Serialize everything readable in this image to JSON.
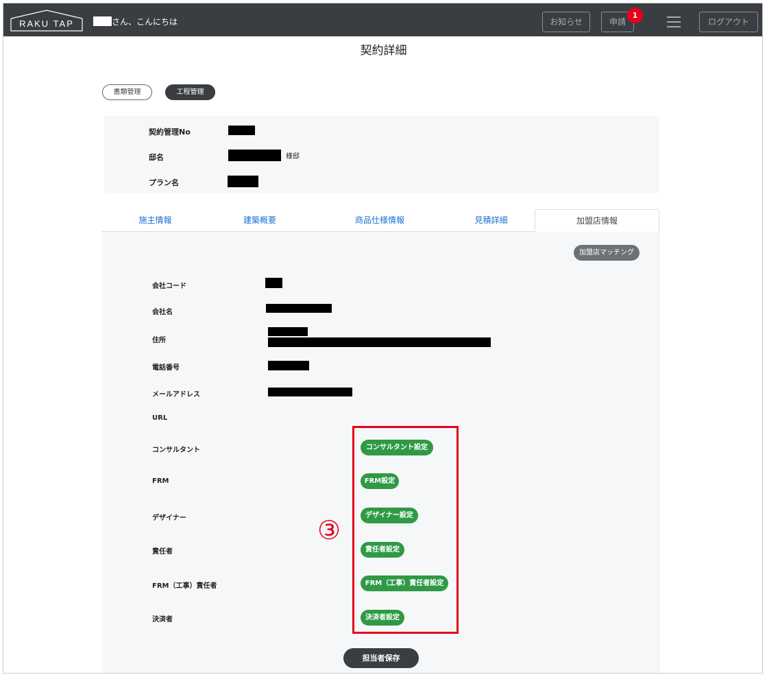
{
  "header": {
    "logo_text": "RAKU TAP",
    "greeting": "さん、こんにちは",
    "notice_label": "お知らせ",
    "apply_label": "申請",
    "apply_badge": "1",
    "logout_label": "ログアウト"
  },
  "page": {
    "title": "契約詳細"
  },
  "view_toggle": {
    "docs_label": "書類管理",
    "process_label": "工程管理"
  },
  "contract": {
    "no_label": "契約管理No",
    "residence_label": "邸名",
    "residence_suffix": "様邸",
    "plan_label": "プラン名"
  },
  "tabs": [
    {
      "label": "施主情報"
    },
    {
      "label": "建築概要"
    },
    {
      "label": "商品仕様情報"
    },
    {
      "label": "見積詳細"
    },
    {
      "label": "加盟店情報"
    }
  ],
  "franchise": {
    "match_button": "加盟店マッチング",
    "fields": {
      "company_code": "会社コード",
      "company_name": "会社名",
      "address": "住所",
      "phone": "電話番号",
      "email": "メールアドレス",
      "url": "URL"
    },
    "assignees": [
      {
        "label": "コンサルタント",
        "button": "コンサルタント設定"
      },
      {
        "label": "FRM",
        "button": "FRM設定"
      },
      {
        "label": "デザイナー",
        "button": "デザイナー設定"
      },
      {
        "label": "責任者",
        "button": "責任者設定"
      },
      {
        "label": "FRM（工事）責任者",
        "button": "FRM（工事）責任者設定"
      },
      {
        "label": "決済者",
        "button": "決済者設定"
      }
    ],
    "save_button": "担当者保存"
  },
  "annotation": {
    "marker": "③",
    "color": "#e8001c"
  },
  "colors": {
    "header_bg": "#3a3d42",
    "accent_green": "#2f9a45",
    "tab_link": "#1a6fd0",
    "panel_bg": "#f6f7f8"
  }
}
